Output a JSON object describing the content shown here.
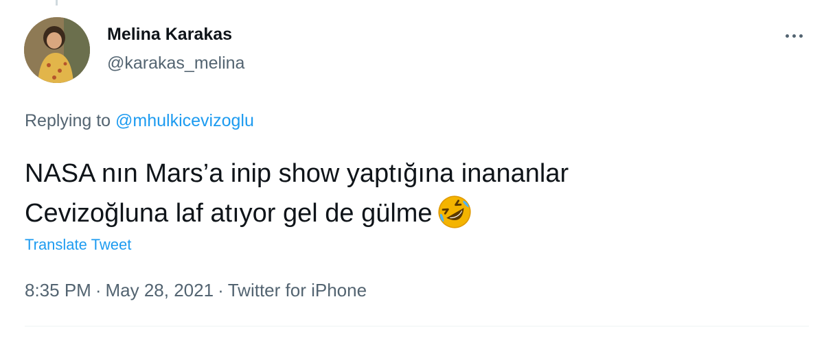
{
  "tweet": {
    "display_name": "Melina Karakas",
    "handle": "@karakas_melina",
    "replying_prefix": "Replying to",
    "replying_to": "@mhulkicevizoglu",
    "text_line1": "NASA nın Mars’a inip show yaptığına inananlar",
    "text_line2": "Cevizoğluna laf atıyor gel de gülme",
    "emoji": "rolling-on-the-floor-laughing-emoji",
    "translate_label": "Translate Tweet",
    "time": "8:35 PM",
    "date": "May 28, 2021",
    "source": "Twitter for iPhone",
    "separator": "·"
  },
  "icons": {
    "more": "more-horizontal-icon"
  },
  "colors": {
    "accent": "#1d9bf0",
    "secondary_text": "#536471",
    "primary_text": "#0f1419",
    "emoji_face": "#f4b400"
  }
}
